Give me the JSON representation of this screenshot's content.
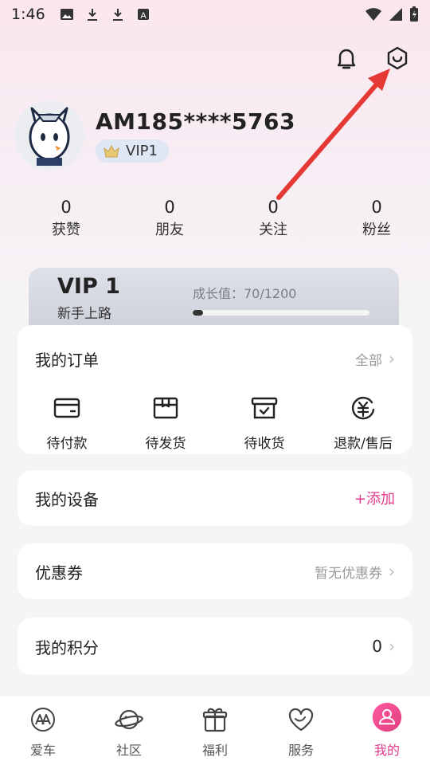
{
  "status_bar": {
    "time": "1:46",
    "icons": [
      "image-icon",
      "download-icon",
      "download-icon",
      "a-icon"
    ],
    "right_icons": [
      "wifi-icon",
      "signal-icon",
      "battery-icon"
    ]
  },
  "header": {
    "icons": [
      "bell-icon",
      "settings-hex-icon"
    ]
  },
  "profile": {
    "username": "AM185****5763",
    "vip_badge": "VIP1"
  },
  "stats": [
    {
      "value": "0",
      "label": "获赞"
    },
    {
      "value": "0",
      "label": "朋友"
    },
    {
      "value": "0",
      "label": "关注"
    },
    {
      "value": "0",
      "label": "粉丝"
    }
  ],
  "vip_card": {
    "level": "VIP 1",
    "subtitle": "新手上路",
    "growth_label": "成长值：70/1200",
    "growth_progress": 0.058
  },
  "orders": {
    "title": "我的订单",
    "all_label": "全部",
    "items": [
      {
        "label": "待付款",
        "icon": "wallet-icon"
      },
      {
        "label": "待发货",
        "icon": "box-icon"
      },
      {
        "label": "待收货",
        "icon": "receive-box-icon"
      },
      {
        "label": "退款/售后",
        "icon": "refund-icon"
      }
    ]
  },
  "device": {
    "title": "我的设备",
    "action": "+添加"
  },
  "coupon": {
    "title": "优惠券",
    "status": "暂无优惠券"
  },
  "points": {
    "title": "我的积分",
    "value": "0"
  },
  "tabbar": [
    {
      "label": "爱车",
      "icon": "car-brand-icon"
    },
    {
      "label": "社区",
      "icon": "planet-icon"
    },
    {
      "label": "福利",
      "icon": "gift-icon"
    },
    {
      "label": "服务",
      "icon": "heart-icon"
    },
    {
      "label": "我的",
      "icon": "profile-icon",
      "active": true
    }
  ],
  "colors": {
    "accent": "#e03d8d",
    "annotation_arrow": "#e53935"
  }
}
